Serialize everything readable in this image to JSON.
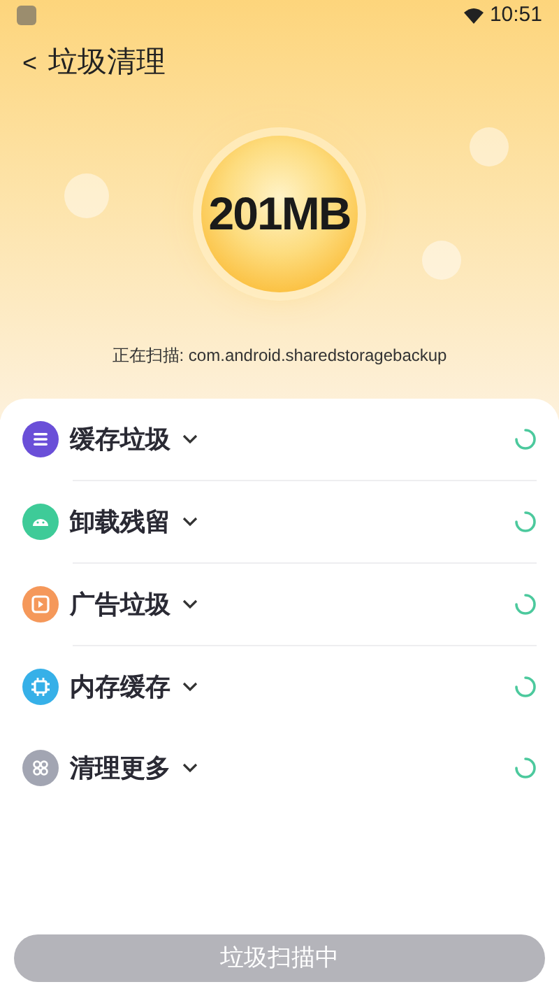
{
  "status_bar": {
    "time": "10:51"
  },
  "header": {
    "back": "<",
    "title": "垃圾清理"
  },
  "scan": {
    "size": "201MB",
    "status": "正在扫描: com.android.sharedstoragebackup"
  },
  "categories": [
    {
      "label": "缓存垃圾",
      "kind": "list",
      "color": "#6a4fd8",
      "loading": true
    },
    {
      "label": "卸载残留",
      "kind": "android",
      "color": "#3ecb98",
      "loading": true
    },
    {
      "label": "广告垃圾",
      "kind": "play",
      "color": "#f5985a",
      "loading": true
    },
    {
      "label": "内存缓存",
      "kind": "chip",
      "color": "#36b0e8",
      "loading": true
    },
    {
      "label": "清理更多",
      "kind": "grid",
      "color": "#a2a5b2",
      "loading": true
    }
  ],
  "button": {
    "label": "垃圾扫描中"
  }
}
